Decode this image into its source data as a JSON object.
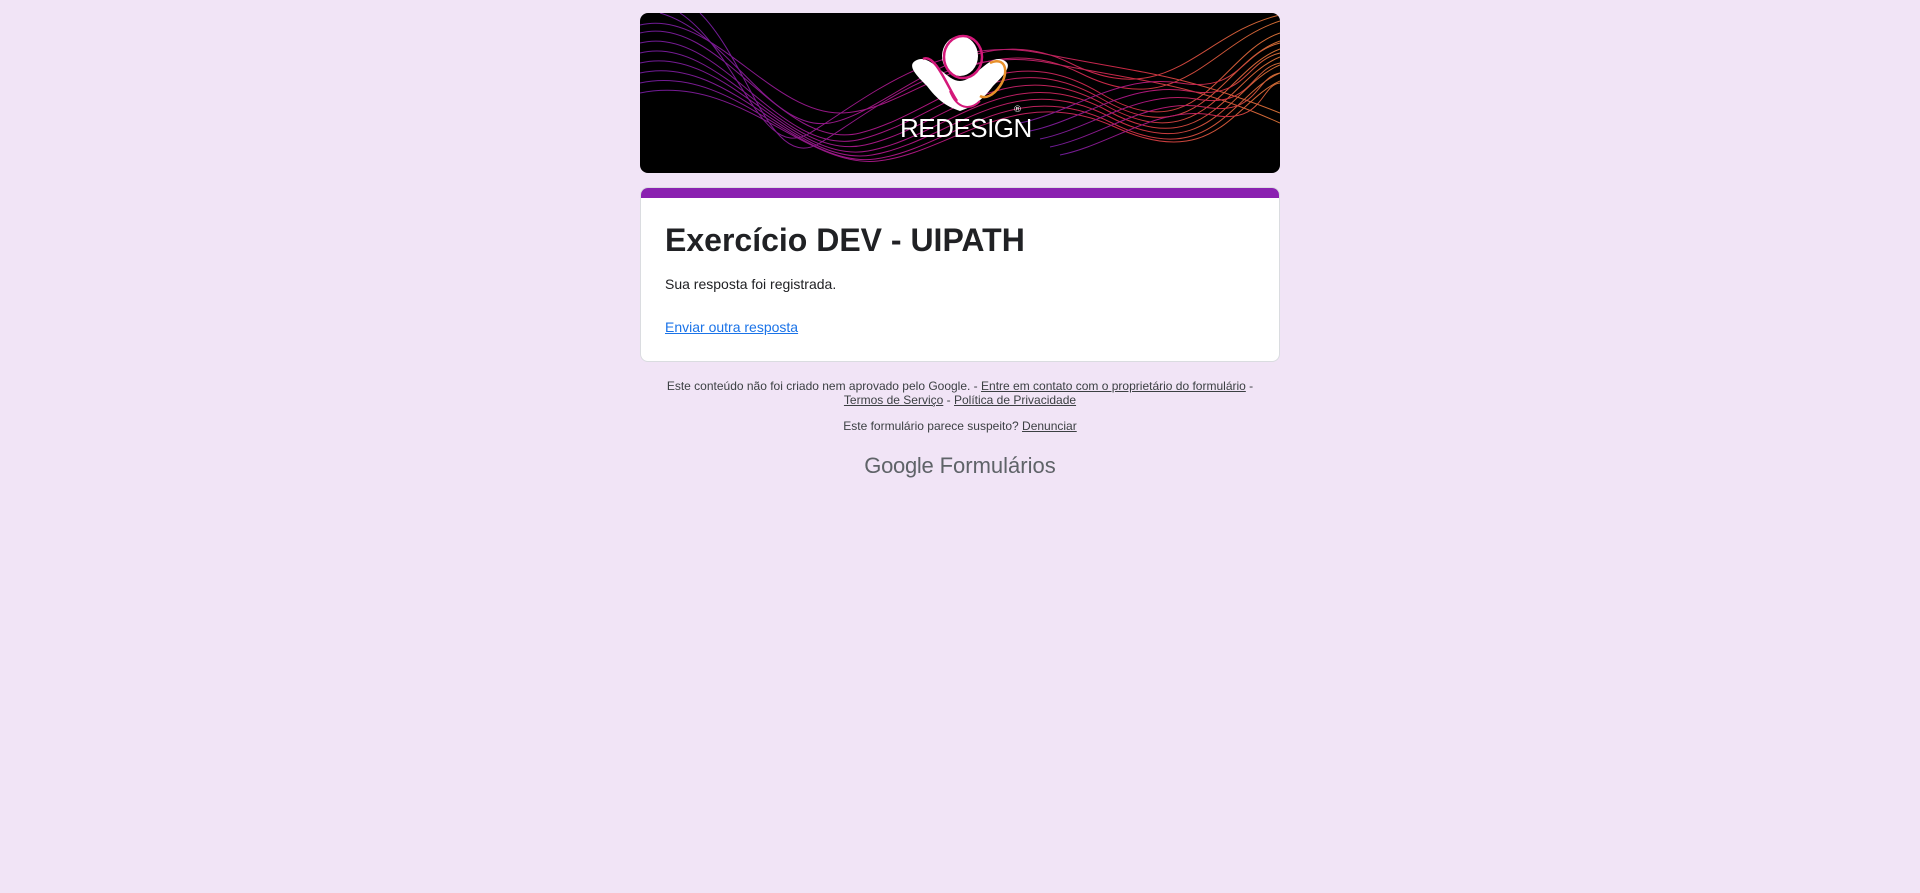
{
  "banner": {
    "brand_text": "REDESIGN",
    "registered_mark": "®"
  },
  "form": {
    "title": "Exercício DEV - UIPATH",
    "confirmation": "Sua resposta foi registrada.",
    "another_response_link": "Enviar outra resposta",
    "accent_color": "#8a21b0"
  },
  "footer": {
    "disclaimer": "Este conteúdo não foi criado nem aprovado pelo Google. -",
    "contact_owner_link": "Entre em contato com o proprietário do formulário",
    "separator1": "-",
    "terms_link": "Termos de Serviço",
    "separator2": "-",
    "privacy_link": "Política de Privacidade",
    "suspicious_text": "Este formulário parece suspeito?",
    "report_link": "Denunciar"
  },
  "brand": {
    "google": "Google",
    "product": "Formulários"
  },
  "colors": {
    "page_background": "#f1e4f6",
    "link": "#1a73e8"
  }
}
